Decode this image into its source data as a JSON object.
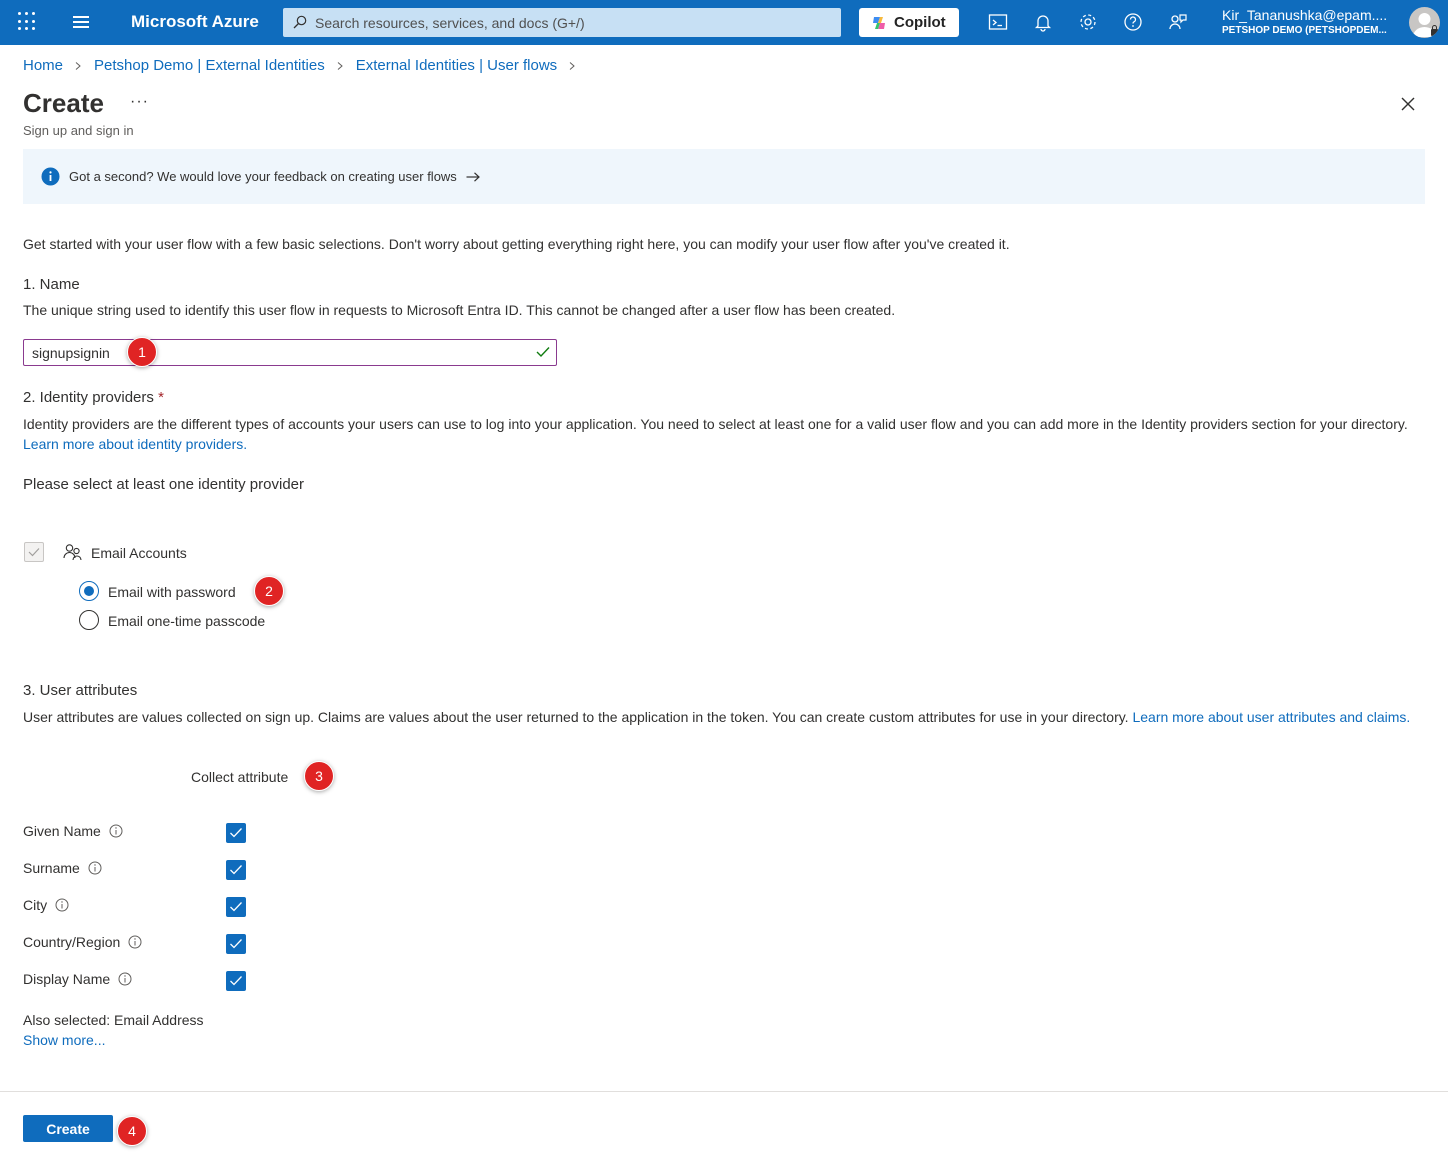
{
  "topbar": {
    "brand": "Microsoft Azure",
    "search_placeholder": "Search resources, services, and docs (G+/)",
    "copilot_label": "Copilot",
    "user_email": "Kir_Tananushka@epam....",
    "user_tenant": "PETSHOP DEMO (PETSHOPDEM..."
  },
  "breadcrumb": {
    "items": [
      "Home",
      "Petshop Demo | External Identities",
      "External Identities | User flows"
    ]
  },
  "page": {
    "title": "Create",
    "ellipsis": "···",
    "subtitle": "Sign up and sign in"
  },
  "info_bar": {
    "text": "Got a second? We would love your feedback on creating user flows"
  },
  "intro": "Get started with your user flow with a few basic selections. Don't worry about getting everything right here, you can modify your user flow after you've created it.",
  "name_section": {
    "heading": "1. Name",
    "description": "The unique string used to identify this user flow in requests to Microsoft Entra ID. This cannot be changed after a user flow has been created.",
    "value": "signupsignin"
  },
  "idp_section": {
    "heading": "2. Identity providers",
    "required_mark": "*",
    "description": "Identity providers are the different types of accounts your users can use to log into your application. You need to select at least one for a valid user flow and you can add more in the Identity providers section for your directory.",
    "learn_more": "Learn more about identity providers.",
    "prompt": "Please select at least one identity provider",
    "email_accounts_label": "Email Accounts",
    "options": [
      {
        "label": "Email with password",
        "selected": true
      },
      {
        "label": "Email one-time passcode",
        "selected": false
      }
    ]
  },
  "attr_section": {
    "heading": "3. User attributes",
    "description": "User attributes are values collected on sign up. Claims are values about the user returned to the application in the token. You can create custom attributes for use in your directory.",
    "learn_more_1": "Learn more about user attributes and",
    "learn_more_2": "claims.",
    "column_header": "Collect attribute",
    "attributes": [
      {
        "label": "Given Name",
        "checked": true
      },
      {
        "label": "Surname",
        "checked": true
      },
      {
        "label": "City",
        "checked": true
      },
      {
        "label": "Country/Region",
        "checked": true
      },
      {
        "label": "Display Name",
        "checked": true
      }
    ],
    "also_selected": "Also selected: Email Address",
    "show_more": "Show more..."
  },
  "footer": {
    "create_label": "Create"
  },
  "markers": [
    "1",
    "2",
    "3",
    "4"
  ],
  "colors": {
    "accent": "#0f6cbd",
    "marker": "#e02424",
    "info_bg": "#eff6fc"
  }
}
